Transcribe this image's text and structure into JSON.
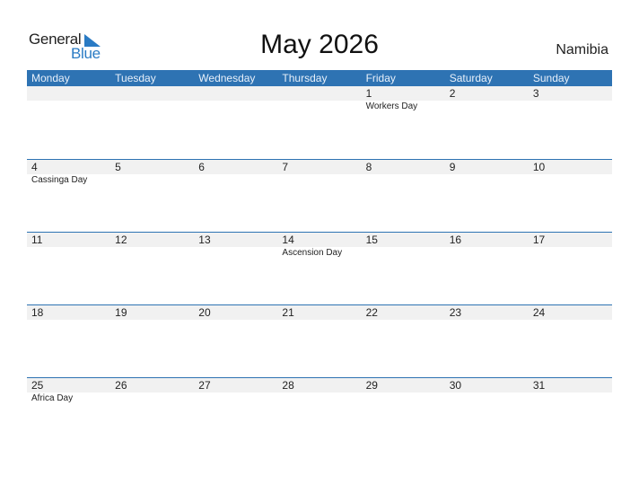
{
  "logo": {
    "word1": "General",
    "word2": "Blue"
  },
  "title": "May 2026",
  "country": "Namibia",
  "weekdays": [
    "Monday",
    "Tuesday",
    "Wednesday",
    "Thursday",
    "Friday",
    "Saturday",
    "Sunday"
  ],
  "weeks": [
    {
      "days": [
        "",
        "",
        "",
        "",
        "1",
        "2",
        "3"
      ],
      "holidays": [
        "",
        "",
        "",
        "",
        "Workers Day",
        "",
        ""
      ]
    },
    {
      "days": [
        "4",
        "5",
        "6",
        "7",
        "8",
        "9",
        "10"
      ],
      "holidays": [
        "Cassinga Day",
        "",
        "",
        "",
        "",
        "",
        ""
      ]
    },
    {
      "days": [
        "11",
        "12",
        "13",
        "14",
        "15",
        "16",
        "17"
      ],
      "holidays": [
        "",
        "",
        "",
        "Ascension Day",
        "",
        "",
        ""
      ]
    },
    {
      "days": [
        "18",
        "19",
        "20",
        "21",
        "22",
        "23",
        "24"
      ],
      "holidays": [
        "",
        "",
        "",
        "",
        "",
        "",
        ""
      ]
    },
    {
      "days": [
        "25",
        "26",
        "27",
        "28",
        "29",
        "30",
        "31"
      ],
      "holidays": [
        "Africa Day",
        "",
        "",
        "",
        "",
        "",
        ""
      ]
    }
  ],
  "colors": {
    "accent": "#2e73b3",
    "logo_blue": "#2a7bc4",
    "day_row_bg": "#f1f1f1"
  }
}
